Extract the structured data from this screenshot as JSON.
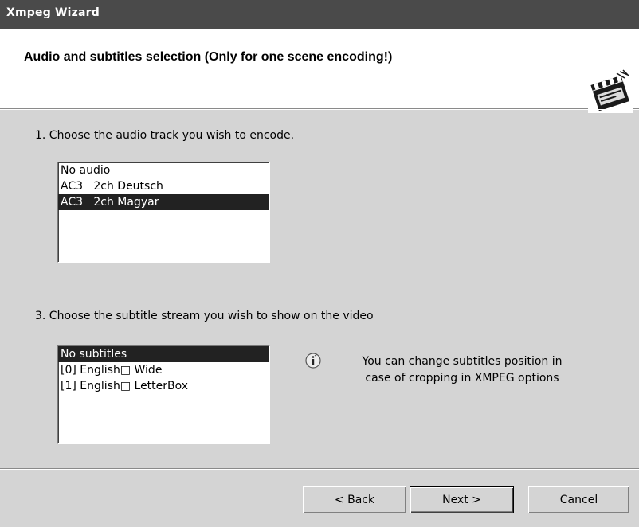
{
  "window": {
    "title": "Xmpeg Wizard"
  },
  "header": {
    "title": "Audio and subtitles selection (Only for one scene encoding!)",
    "logo_icon": "clapperboard-icon"
  },
  "audio": {
    "label": "1. Choose the audio track you wish to encode.",
    "items": [
      "No audio",
      "AC3   2ch Deutsch",
      "AC3   2ch Magyar"
    ],
    "selected": "AC3   2ch Magyar"
  },
  "subtitles": {
    "label": "3. Choose the subtitle stream you wish to show on the video",
    "items": [
      "No subtitles",
      "[0] English□ Wide",
      "[1] English□ LetterBox"
    ],
    "selected": "No subtitles"
  },
  "info": {
    "icon": "info-icon",
    "text": "You can change subtitles position in\ncase of cropping in XMPEG options"
  },
  "buttons": {
    "back": "< Back",
    "next": "Next >",
    "cancel": "Cancel"
  }
}
